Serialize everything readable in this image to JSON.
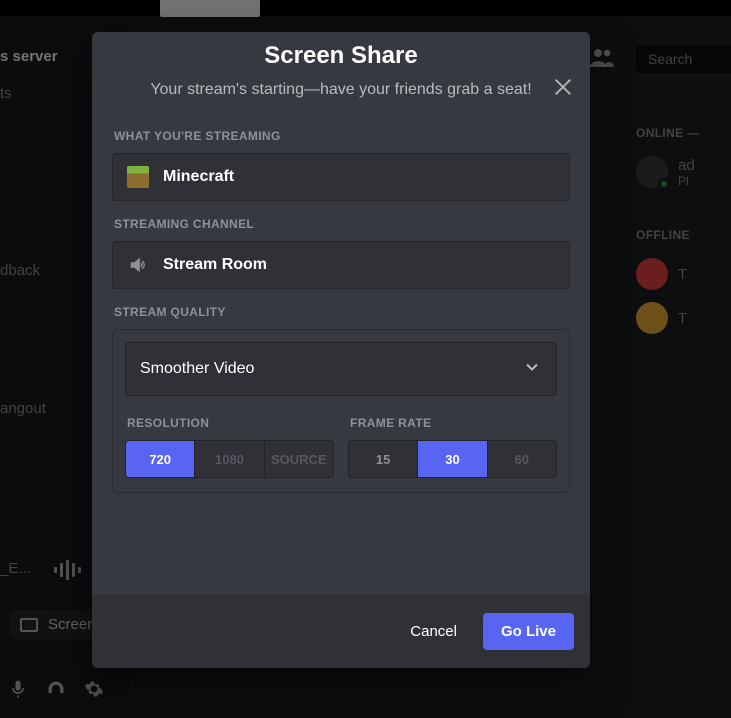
{
  "background": {
    "server_name": "s server",
    "server_channel_hint": "ts",
    "left_items": [
      "dback",
      "angout",
      "_E..."
    ],
    "screens_label": "Screen",
    "search_placeholder": "Search",
    "right": {
      "online_label": "ONLINE —",
      "offline_label": "OFFLINE",
      "users": [
        {
          "name": "ad",
          "sub": "Pl"
        },
        {
          "name": "T"
        },
        {
          "name": "T"
        }
      ]
    }
  },
  "modal": {
    "title": "Screen Share",
    "subtitle": "Your stream's starting—have your friends grab a seat!",
    "sections": {
      "streaming_label": "WHAT YOU'RE STREAMING",
      "streaming_value": "Minecraft",
      "channel_label": "STREAMING CHANNEL",
      "channel_value": "Stream Room",
      "quality_label": "STREAM QUALITY",
      "quality_preset": "Smoother Video",
      "resolution_label": "RESOLUTION",
      "framerate_label": "FRAME RATE",
      "resolution_options": {
        "opt720": "720",
        "opt1080": "1080",
        "optSource": "SOURCE"
      },
      "framerate_options": {
        "opt15": "15",
        "opt30": "30",
        "opt60": "60"
      },
      "resolution_active": "opt720",
      "framerate_active": "opt30"
    },
    "buttons": {
      "cancel": "Cancel",
      "go_live": "Go Live"
    }
  }
}
